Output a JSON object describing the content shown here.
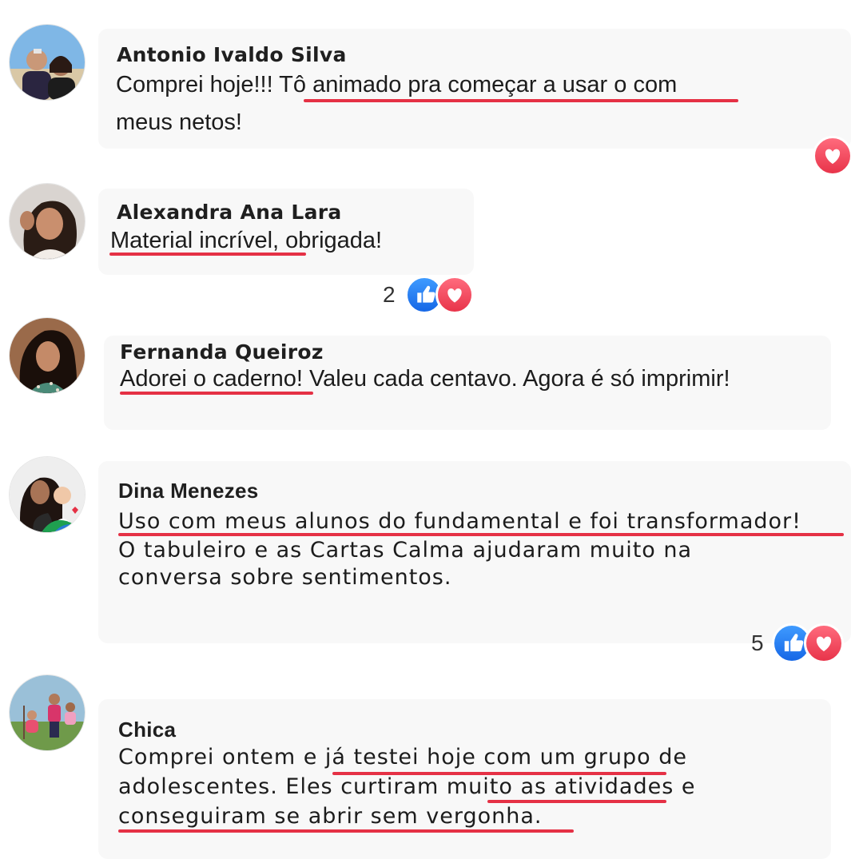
{
  "colors": {
    "bubble_bg": "#f8f8f8",
    "underline": "#e53145",
    "like_blue": "#1877f2",
    "love_red": "#f0384f"
  },
  "comments": [
    {
      "author": "Antonio Ivaldo Silva",
      "lines": [
        "Comprei hoje!!! Tô animado pra começar a usar o com",
        "meus netos!"
      ],
      "reactions": {
        "icons": [
          "love-icon"
        ]
      }
    },
    {
      "author": "Alexandra Ana Lara",
      "lines": [
        "Material incrível, obrigada!"
      ],
      "reactions": {
        "count": "2",
        "icons": [
          "like-icon",
          "love-icon"
        ]
      }
    },
    {
      "author": "Fernanda Queiroz",
      "lines": [
        "Adorei o caderno! Valeu cada centavo. Agora é só imprimir!"
      ]
    },
    {
      "author": "Dina Menezes",
      "lines": [
        "Uso com meus alunos do fundamental e foi transformador!",
        "O tabuleiro e as Cartas Calma ajudaram muito na",
        "conversa sobre sentimentos."
      ],
      "reactions": {
        "count": "5",
        "icons": [
          "like-icon",
          "love-icon"
        ]
      }
    },
    {
      "author": "Chica",
      "lines": [
        "Comprei ontem e já testei hoje com um grupo de",
        "adolescentes. Eles curtiram muito as atividades e",
        "conseguiram se abrir sem vergonha."
      ]
    }
  ]
}
